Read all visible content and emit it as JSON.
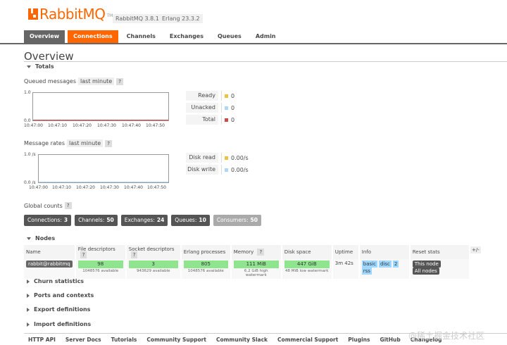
{
  "header": {
    "logo_text": "RabbitMQ",
    "logo_tm": "TM",
    "version": "RabbitMQ 3.8.15",
    "erlang": "Erlang 23.3.2"
  },
  "tabs": [
    "Overview",
    "Connections",
    "Channels",
    "Exchanges",
    "Queues",
    "Admin"
  ],
  "page_title": "Overview",
  "totals": {
    "title": "Totals",
    "queued_label": "Queued messages",
    "queued_range": "last minute",
    "rates_label": "Message rates",
    "rates_range": "last minute",
    "help": "?",
    "queued_y_top": "1.0",
    "queued_y_bottom": "0.0",
    "rates_y_top": "1.0 /s",
    "rates_y_bottom": "0.0 /s",
    "x_ticks": [
      "10:47:00",
      "10:47:10",
      "10:47:20",
      "10:47:30",
      "10:47:40",
      "10:47:50"
    ],
    "queued_legend": [
      {
        "name": "Ready",
        "value": "0",
        "color": "#edc240"
      },
      {
        "name": "Unacked",
        "value": "0",
        "color": "#afd8f8"
      },
      {
        "name": "Total",
        "value": "0",
        "color": "#cb4b4b"
      }
    ],
    "rates_legend": [
      {
        "name": "Disk read",
        "value": "0.00/s",
        "color": "#edc240"
      },
      {
        "name": "Disk write",
        "value": "0.00/s",
        "color": "#afd8f8"
      }
    ]
  },
  "global_counts": {
    "label": "Global counts",
    "help": "?",
    "items": [
      {
        "name": "Connections:",
        "value": "3"
      },
      {
        "name": "Channels:",
        "value": "50"
      },
      {
        "name": "Exchanges:",
        "value": "24"
      },
      {
        "name": "Queues:",
        "value": "10"
      },
      {
        "name": "Consumers:",
        "value": "50"
      }
    ]
  },
  "nodes": {
    "title": "Nodes",
    "headers": [
      "Name",
      "File descriptors",
      "Socket descriptors",
      "Erlang processes",
      "Memory",
      "Disk space",
      "Uptime",
      "Info",
      "Reset stats"
    ],
    "help": "?",
    "plus_minus": "+/-",
    "row": {
      "name": "rabbit@rabbitmq",
      "fd": "98",
      "fd_sub": "1048576 available",
      "sd": "3",
      "sd_sub": "943629 available",
      "ep": "805",
      "ep_sub": "1048576 available",
      "mem": "111 MiB",
      "mem_sub": "6.2 GiB high watermark",
      "disk": "447 GiB",
      "disk_sub": "48 MiB low watermark",
      "uptime": "3m 42s",
      "info": [
        "basic",
        "disc",
        "2",
        "rss"
      ],
      "reset_this": "This node",
      "reset_all": "All nodes"
    }
  },
  "collapsed_sections": [
    "Churn statistics",
    "Ports and contexts",
    "Export definitions",
    "Import definitions"
  ],
  "footer": [
    "HTTP API",
    "Server Docs",
    "Tutorials",
    "Community Support",
    "Community Slack",
    "Commercial Support",
    "Plugins",
    "GitHub",
    "Changelog"
  ],
  "watermark": "@稀土掘金技术社区"
}
